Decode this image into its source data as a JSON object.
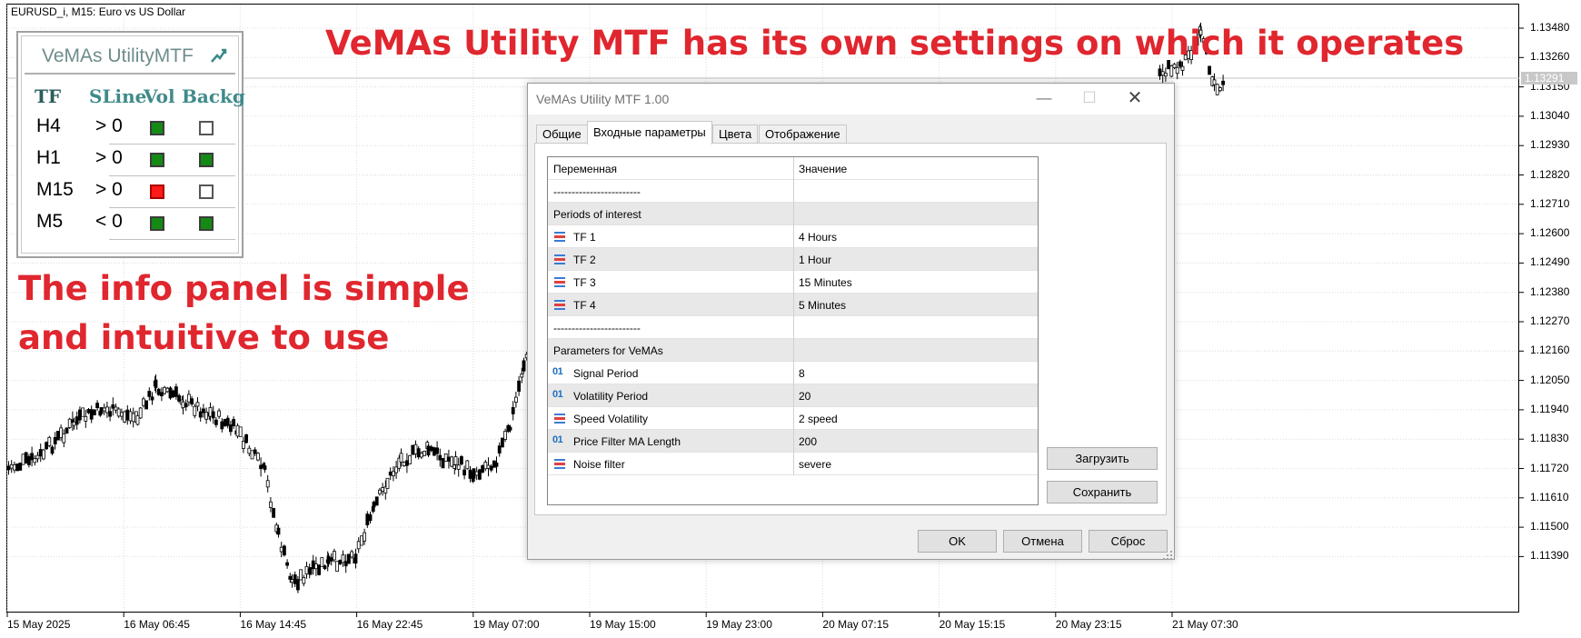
{
  "chart": {
    "symbol_label": "EURUSD_i, M15:  Euro vs US Dollar",
    "current_price": "1.13291",
    "y_ticks": [
      "1.13480",
      "1.13260",
      "1.13150",
      "1.13040",
      "1.12930",
      "1.12820",
      "1.12710",
      "1.12600",
      "1.12490",
      "1.12380",
      "1.12270",
      "1.12160",
      "1.12050",
      "1.11940",
      "1.11830",
      "1.11720",
      "1.11610",
      "1.11500",
      "1.11390"
    ],
    "x_ticks": [
      "15 May 2025",
      "16 May 06:45",
      "16 May 14:45",
      "16 May 22:45",
      "19 May 07:00",
      "19 May 15:00",
      "19 May 23:00",
      "20 May 07:15",
      "20 May 15:15",
      "20 May 23:15",
      "21 May 07:30"
    ],
    "candle_color": "#000000",
    "grid_color": "#dcdcdc"
  },
  "annotations": {
    "top": "VeMAs Utility MTF has its own settings on which it operates",
    "left_line1": "The info panel is simple",
    "left_line2": "and intuitive to use",
    "color": "#e0262e"
  },
  "info_panel": {
    "title": "VeMAs UtilityMTF",
    "logo_icon": "chart-trend-icon",
    "headers": {
      "tf": "TF",
      "sline": "SLine",
      "vol": "Vol",
      "backg": "Backg"
    },
    "rows": [
      {
        "tf": "H4",
        "sline": "> 0",
        "vol": "green",
        "backg": "empty"
      },
      {
        "tf": "H1",
        "sline": "> 0",
        "vol": "green",
        "backg": "green"
      },
      {
        "tf": "M15",
        "sline": "> 0",
        "vol": "red",
        "backg": "empty"
      },
      {
        "tf": "M5",
        "sline": "< 0",
        "vol": "green",
        "backg": "green"
      }
    ],
    "colors": {
      "green": "#148a14",
      "red": "#ff1a1a"
    }
  },
  "dialog": {
    "title": "VeMAs Utility MTF 1.00",
    "tabs": [
      "Общие",
      "Входные параметры",
      "Цвета",
      "Отображение"
    ],
    "active_tab": 1,
    "columns": {
      "variable": "Переменная",
      "value": "Значение"
    },
    "rows": [
      {
        "icon": "",
        "name": "------------------------",
        "value": "",
        "shade": false
      },
      {
        "icon": "",
        "name": "Periods of interest",
        "value": "",
        "shade": true
      },
      {
        "icon": "enum-icon",
        "name": "TF 1",
        "value": "4 Hours",
        "shade": false
      },
      {
        "icon": "enum-icon",
        "name": "TF 2",
        "value": "1 Hour",
        "shade": true
      },
      {
        "icon": "enum-icon",
        "name": "TF 3",
        "value": "15 Minutes",
        "shade": false
      },
      {
        "icon": "enum-icon",
        "name": "TF 4",
        "value": "5 Minutes",
        "shade": true
      },
      {
        "icon": "",
        "name": "------------------------",
        "value": "",
        "shade": false
      },
      {
        "icon": "",
        "name": "Parameters for VeMAs",
        "value": "",
        "shade": true
      },
      {
        "icon": "int-icon",
        "name": "Signal Period",
        "value": "8",
        "shade": false
      },
      {
        "icon": "int-icon",
        "name": "Volatility Period",
        "value": "20",
        "shade": true
      },
      {
        "icon": "enum-icon",
        "name": "Speed Volatility",
        "value": "2 speed",
        "shade": false
      },
      {
        "icon": "int-icon",
        "name": "Price Filter MA Length",
        "value": "200",
        "shade": true
      },
      {
        "icon": "enum-icon",
        "name": "Noise filter",
        "value": "severe",
        "shade": false
      }
    ],
    "int_icon_text": "01",
    "buttons": {
      "load": "Загрузить",
      "save": "Сохранить",
      "ok": "OK",
      "cancel": "Отмена",
      "reset": "Сброс"
    }
  }
}
